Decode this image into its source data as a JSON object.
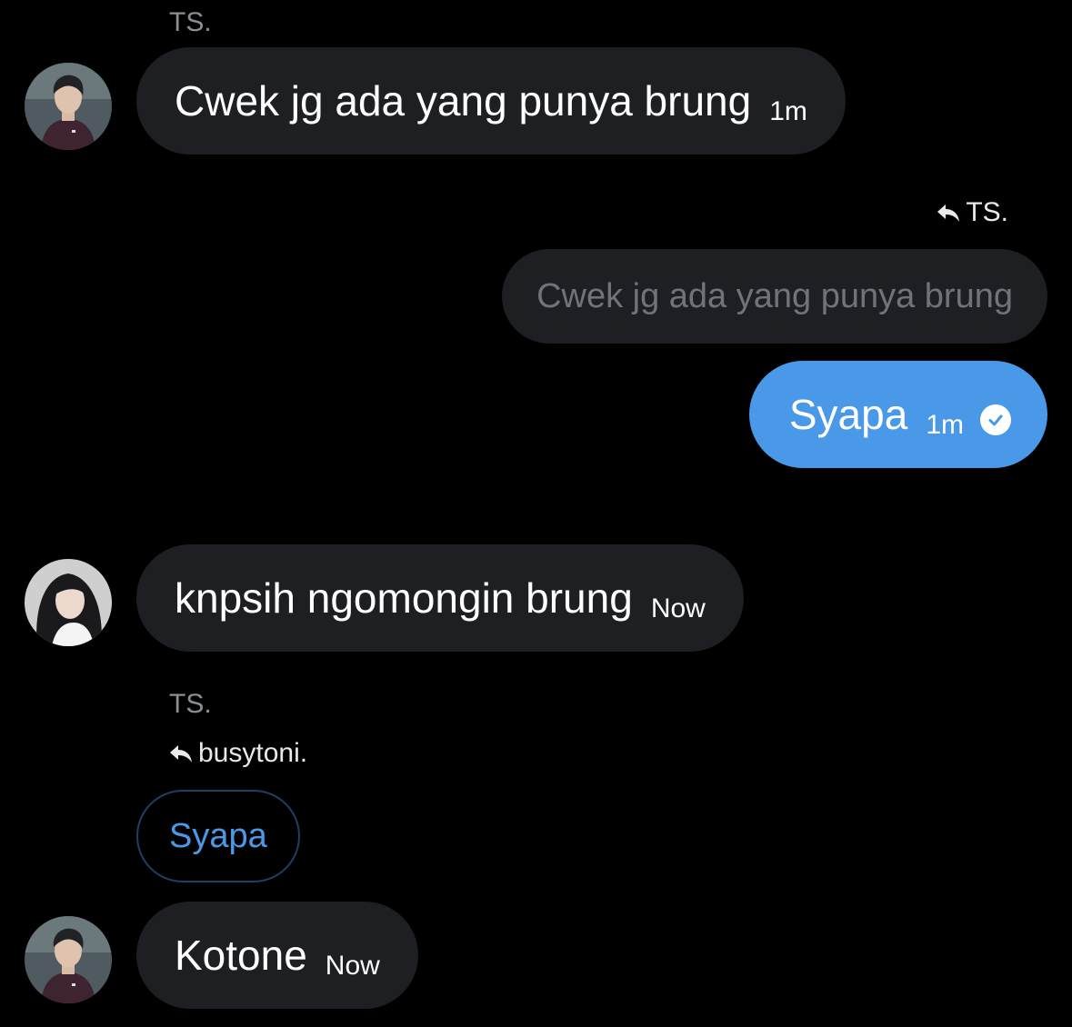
{
  "messages": [
    {
      "sender": "TS.",
      "text": "Cwek jg ada yang punya brung",
      "time": "1m",
      "avatar": "male-avatar"
    },
    {
      "reply_to": "TS.",
      "quoted_text": "Cwek jg ada yang punya brung",
      "text": "Syapa",
      "time": "1m",
      "status_icon": "check-circle-icon"
    },
    {
      "text": "knpsih ngomongin brung",
      "time": "Now",
      "avatar": "female-avatar"
    },
    {
      "sender": "TS.",
      "reply_to": "busytoni.",
      "quoted_text": "Syapa",
      "text": "Kotone",
      "time": "Now",
      "avatar": "male-avatar"
    }
  ],
  "colors": {
    "background": "#000000",
    "incoming_bubble": "#1d1f23",
    "outgoing_bubble": "#4a99e9",
    "sender_name": "#8b8f94",
    "quoted_text": "#6f7479",
    "outline_border": "#1e3f66"
  }
}
